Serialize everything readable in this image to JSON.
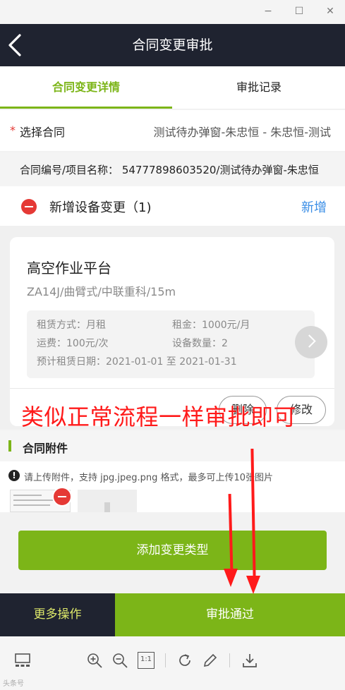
{
  "window": {
    "minimize": "−",
    "maximize": "☐",
    "close": "✕"
  },
  "nav": {
    "title": "合同变更审批"
  },
  "tabs": [
    {
      "label": "合同变更详情",
      "active": true
    },
    {
      "label": "审批记录",
      "active": false
    }
  ],
  "select_contract": {
    "required_mark": "*",
    "label": "选择合同",
    "value": "测试待办弹窗-朱忠恒 - 朱忠恒-测试"
  },
  "contract_code": {
    "text": "合同编号/项目名称： 54777898603520/测试待办弹窗-朱忠恒"
  },
  "equipment_change": {
    "label": "新增设备变更（1)",
    "add_label": "新增"
  },
  "equipment_card": {
    "title": "高空作业平台",
    "model": "ZA14J/曲臂式/中联重科/15m",
    "lease_mode": "租赁方式：月租",
    "rent": "租金：1000元/月",
    "freight": "运费：100元/次",
    "quantity": "设备数量：2",
    "lease_period": "预计租赁日期：2021-01-01 至 2021-01-31",
    "delete_label": "删除",
    "edit_label": "修改"
  },
  "annotation": "类似正常流程一样审批即可",
  "attachments": {
    "title": "合同附件",
    "hint": "请上传附件，支持 jpg.jpeg.png 格式，最多可上传10张图片"
  },
  "add_change_type_label": "添加变更类型",
  "footer": {
    "more_label": "更多操作",
    "approve_label": "审批通过"
  },
  "viewer_toolbar": {
    "icons": [
      "thumbnail-icon",
      "zoom-in-icon",
      "zoom-out-icon",
      "actual-size-icon",
      "rotate-icon",
      "edit-icon",
      "download-icon"
    ],
    "actual_size_text": "1:1",
    "watermark": "头条号"
  },
  "colors": {
    "accent": "#7cb518",
    "nav_bg": "#1f2330",
    "danger": "#e53935",
    "link": "#3a8ee6",
    "annotation": "#ff1a1a"
  }
}
